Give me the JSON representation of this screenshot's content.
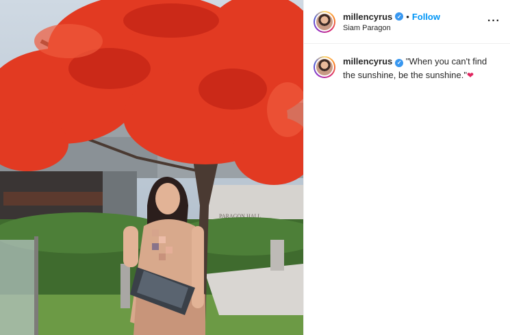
{
  "post": {
    "username": "millencyrus",
    "verified_mark": "✓",
    "separator": "•",
    "follow_label": "Follow",
    "location": "Siam Paragon",
    "more_label": "···",
    "caption_text": " \"When you can't find the sunshine, be the sunshine.\"",
    "caption_emoji": "❤",
    "photo_sign_text": "PARAGON HALL"
  },
  "colors": {
    "accent": "#0095f6",
    "verified": "#3897f0",
    "tree_red": "#e23a22"
  },
  "icons": {
    "more": "more-options-icon",
    "verified": "verified-badge-icon",
    "heart": "red-heart-emoji"
  }
}
